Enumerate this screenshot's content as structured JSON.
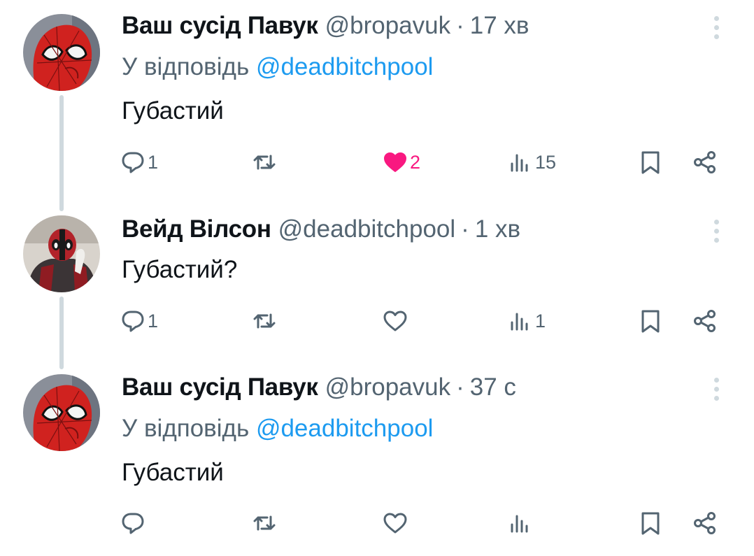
{
  "tweets": [
    {
      "avatar": "spider-man-avatar",
      "display_name": "Ваш сусід Павук",
      "handle": "@bropavuk",
      "separator": "·",
      "time": "17 хв",
      "reply_prefix": "У відповідь",
      "reply_to": "@deadbitchpool",
      "text": "Губастий",
      "replies": "1",
      "retweets": "",
      "likes": "2",
      "liked": true,
      "views": "15"
    },
    {
      "avatar": "deadpool-avatar",
      "display_name": "Вейд Вілсон",
      "handle": "@deadbitchpool",
      "separator": "·",
      "time": "1 хв",
      "text": "Губастий?",
      "replies": "1",
      "retweets": "",
      "likes": "",
      "liked": false,
      "views": "1"
    },
    {
      "avatar": "spider-man-avatar",
      "display_name": "Ваш сусід Павук",
      "handle": "@bropavuk",
      "separator": "·",
      "time": "37 с",
      "reply_prefix": "У відповідь",
      "reply_to": "@deadbitchpool",
      "text": "Губастий",
      "replies": "",
      "retweets": "",
      "likes": "",
      "liked": false,
      "views": ""
    }
  ],
  "icons": {
    "reply": "reply-icon",
    "retweet": "retweet-icon",
    "like": "heart-icon",
    "views": "views-icon",
    "bookmark": "bookmark-icon",
    "share": "share-icon",
    "more": "more-icon"
  },
  "colors": {
    "text": "#0f1419",
    "secondary": "#536471",
    "mention": "#1d9bf0",
    "like": "#f91880",
    "thread_line": "#cfd9de"
  }
}
